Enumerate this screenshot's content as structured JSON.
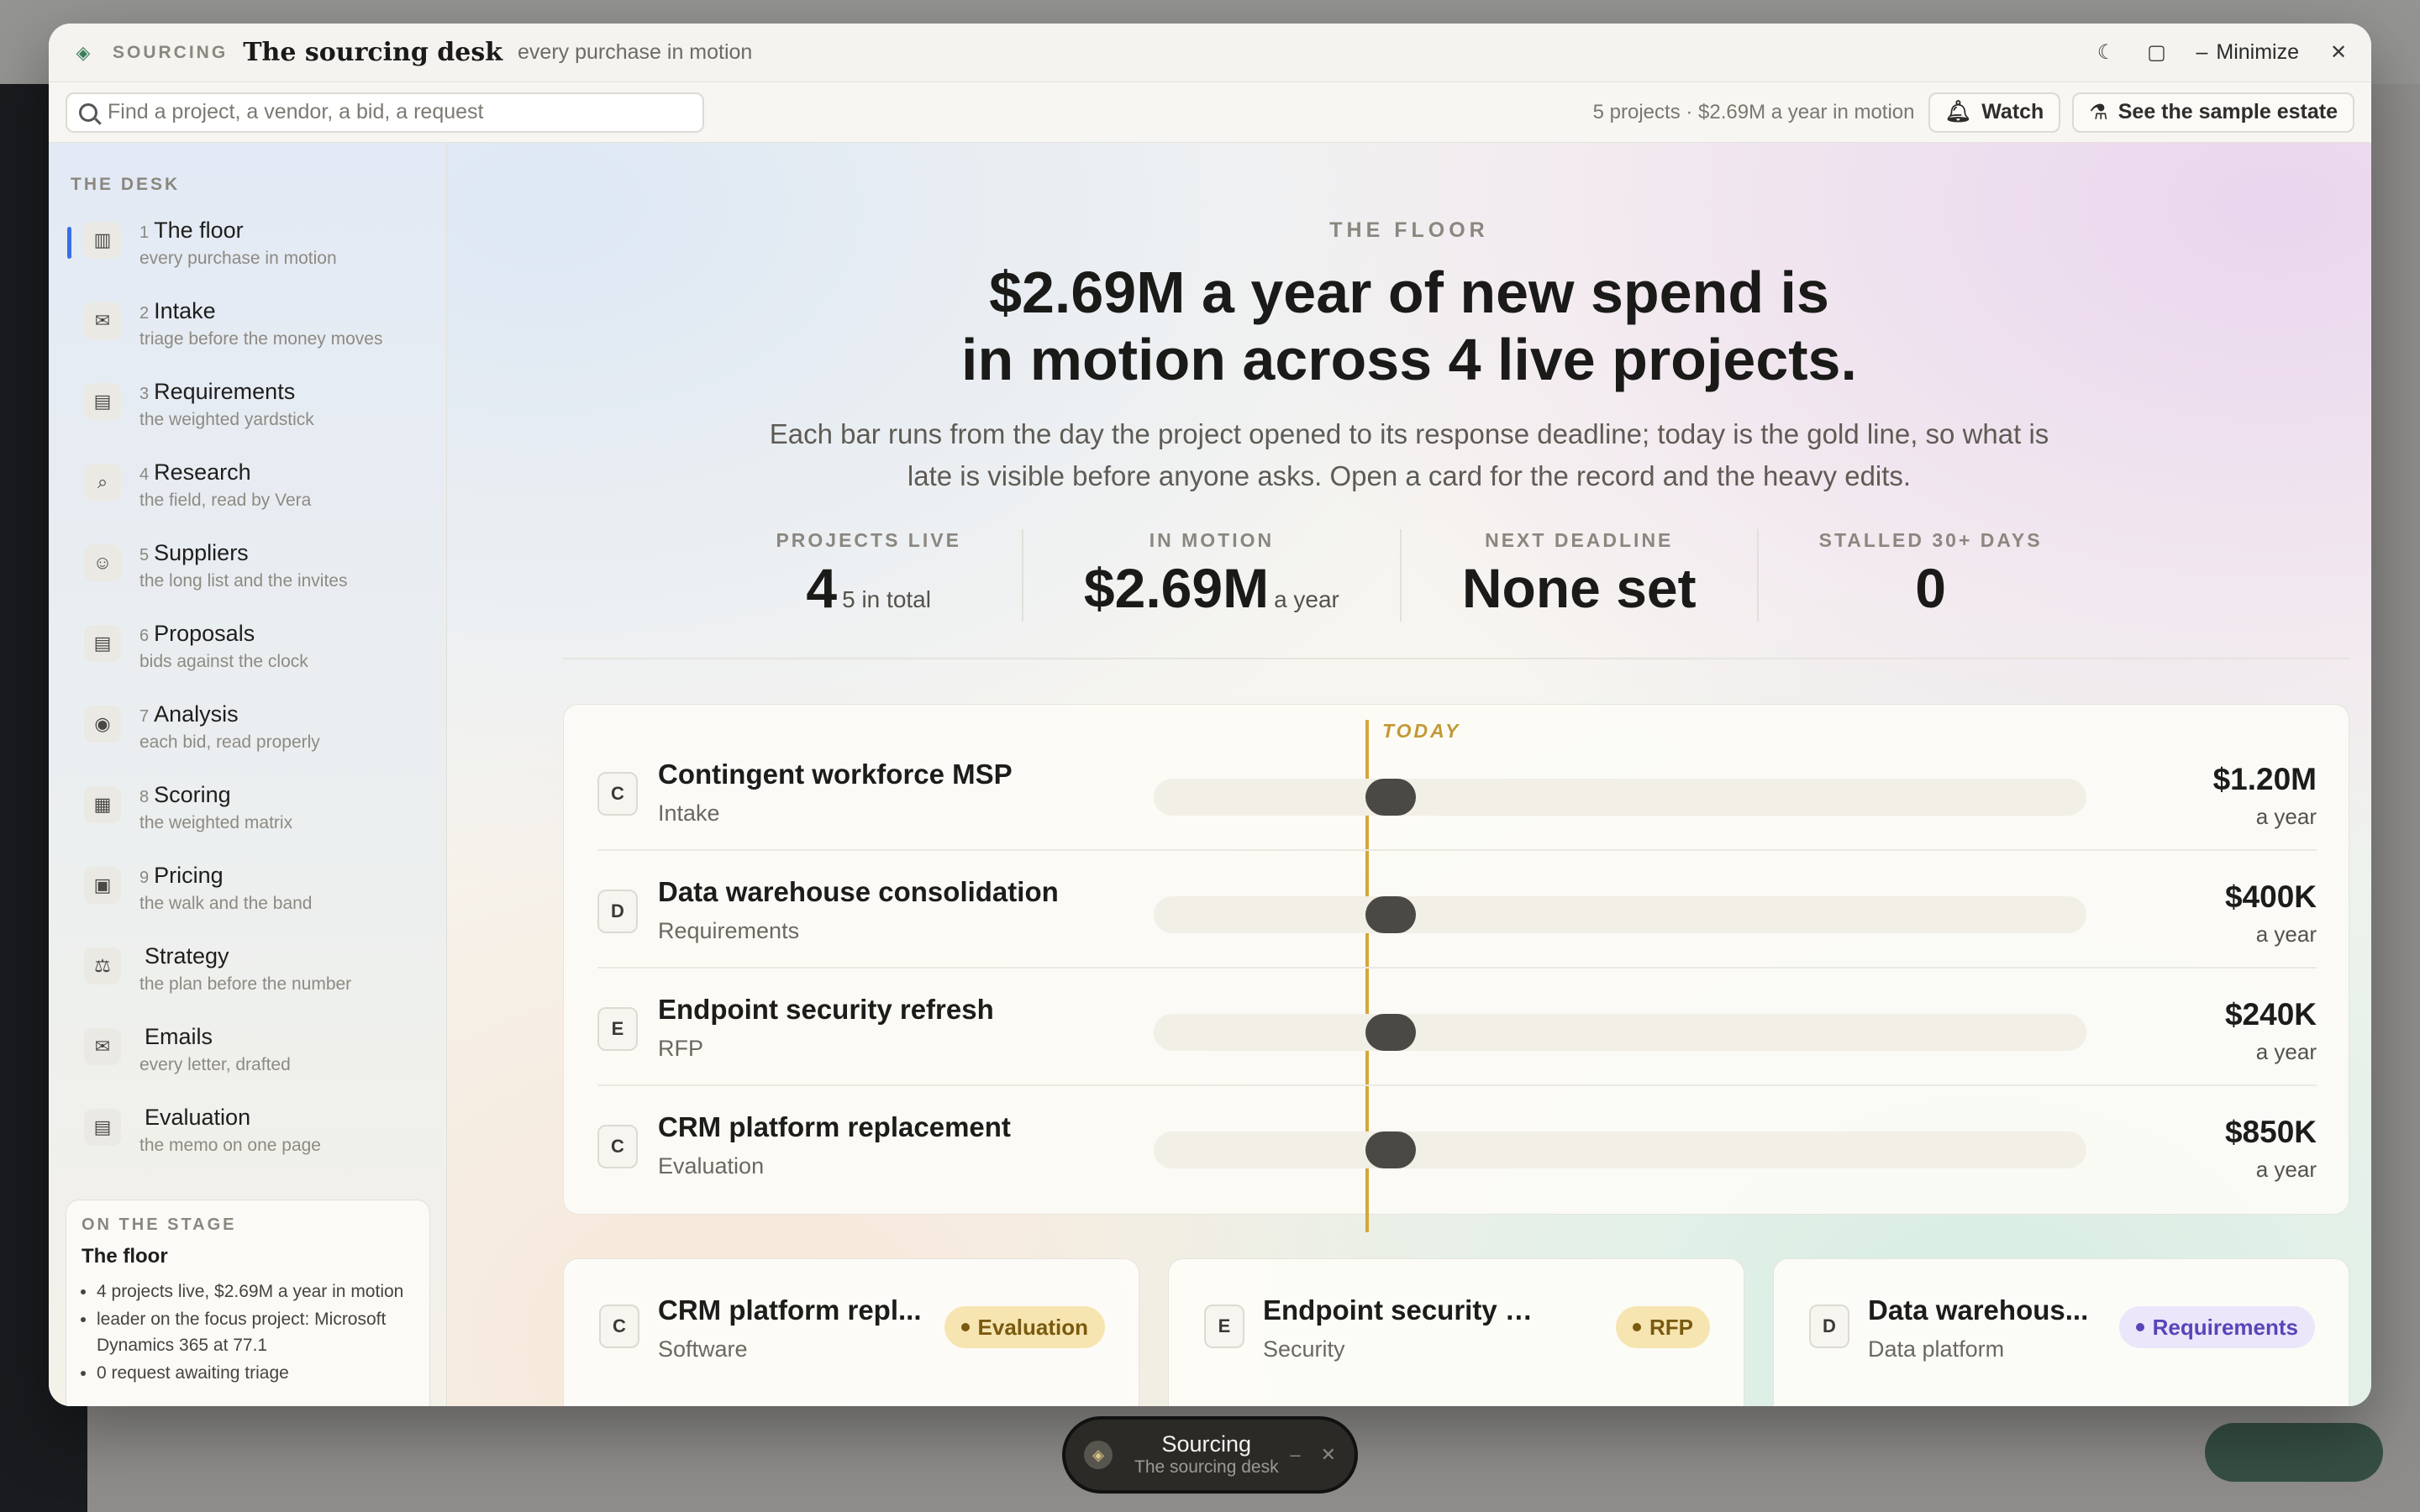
{
  "window": {
    "kicker": "SOURCING",
    "title": "The sourcing desk",
    "subtitle": "every purchase in motion",
    "minimize_label": "Minimize"
  },
  "toolbar": {
    "search_placeholder": "Find a project, a vendor, a bid, a request",
    "summary": "5 projects · $2.69M a year in motion",
    "watch_label": "Watch",
    "sample_label": "See the sample estate"
  },
  "sidebar": {
    "heading": "THE DESK",
    "items": [
      {
        "num": "1",
        "title": "The floor",
        "sub": "every purchase in motion",
        "icon": "bar-chart-icon"
      },
      {
        "num": "2",
        "title": "Intake",
        "sub": "triage before the money moves",
        "icon": "inbox-icon"
      },
      {
        "num": "3",
        "title": "Requirements",
        "sub": "the weighted yardstick",
        "icon": "clipboard-icon"
      },
      {
        "num": "4",
        "title": "Research",
        "sub": "the field, read by Vera",
        "icon": "magnify-icon"
      },
      {
        "num": "5",
        "title": "Suppliers",
        "sub": "the long list and the invites",
        "icon": "users-icon"
      },
      {
        "num": "6",
        "title": "Proposals",
        "sub": "bids against the clock",
        "icon": "document-icon"
      },
      {
        "num": "7",
        "title": "Analysis",
        "sub": "each bid, read properly",
        "icon": "eye-icon"
      },
      {
        "num": "8",
        "title": "Scoring",
        "sub": "the weighted matrix",
        "icon": "grid-icon"
      },
      {
        "num": "9",
        "title": "Pricing",
        "sub": "the walk and the band",
        "icon": "calculator-icon"
      },
      {
        "num": "",
        "title": "Strategy",
        "sub": "the plan before the number",
        "icon": "scales-icon"
      },
      {
        "num": "",
        "title": "Emails",
        "sub": "every letter, drafted",
        "icon": "mail-icon"
      },
      {
        "num": "",
        "title": "Evaluation",
        "sub": "the memo on one page",
        "icon": "memo-icon"
      }
    ],
    "stage": {
      "kicker": "ON THE STAGE",
      "title": "The floor",
      "bullets": [
        "4 projects live, $2.69M a year in motion",
        "leader on the focus project: Microsoft Dynamics 365 at 77.1",
        "0 request awaiting triage"
      ]
    }
  },
  "floor": {
    "kicker": "THE FLOOR",
    "headline_1": "$2.69M a year of new spend is",
    "headline_2": "in motion across 4 live projects.",
    "lede": "Each bar runs from the day the project opened to its response deadline; today is the gold line, so what is late is visible before anyone asks. Open a card for the record and the heavy edits.",
    "stats": [
      {
        "label": "PROJECTS LIVE",
        "value": "4",
        "unit": "5 in total"
      },
      {
        "label": "IN MOTION",
        "value": "$2.69M",
        "unit": "a year"
      },
      {
        "label": "NEXT DEADLINE",
        "value": "None set",
        "unit": ""
      },
      {
        "label": "STALLED 30+ DAYS",
        "value": "0",
        "unit": ""
      }
    ],
    "today_label": "TODAY",
    "timeline": [
      {
        "badge": "C",
        "name": "Contingent workforce MSP",
        "stage": "Intake",
        "amount": "$1.20M",
        "per": "a year",
        "progress": 0.0
      },
      {
        "badge": "D",
        "name": "Data warehouse consolidation",
        "stage": "Requirements",
        "amount": "$400K",
        "per": "a year",
        "progress": 0.0
      },
      {
        "badge": "E",
        "name": "Endpoint security refresh",
        "stage": "RFP",
        "amount": "$240K",
        "per": "a year",
        "progress": 0.0
      },
      {
        "badge": "C",
        "name": "CRM platform replacement",
        "stage": "Evaluation",
        "amount": "$850K",
        "per": "a year",
        "progress": 0.0
      }
    ],
    "cards": [
      {
        "badge": "C",
        "name": "CRM platform repl...",
        "category": "Software",
        "status": "Evaluation",
        "tone": "gold"
      },
      {
        "badge": "E",
        "name": "Endpoint security refresh",
        "category": "Security",
        "status": "RFP",
        "tone": "gold"
      },
      {
        "badge": "D",
        "name": "Data warehous...",
        "category": "Data platform",
        "status": "Requirements",
        "tone": "purple"
      }
    ]
  },
  "dock": {
    "title": "Sourcing",
    "subtitle": "The sourcing desk"
  },
  "colors": {
    "accent": "#3b6ee8",
    "today": "#d4a63a",
    "bar": "#4a4944"
  }
}
